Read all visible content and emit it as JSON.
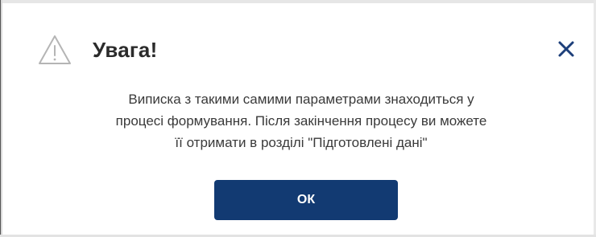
{
  "dialog": {
    "icon": "warning-triangle-icon",
    "title": "Увага!",
    "close_icon": "close-icon",
    "message_lines": [
      "Виписка з такими самими параметрами знаходиться у",
      "процесі формування. Після закінчення процесу ви можете",
      "її отримати в розділі \"Підготовлені дані\""
    ],
    "ok_label": "ОК"
  },
  "colors": {
    "accent": "#123a72",
    "close_icon": "#1d3f7a",
    "title": "#2b2b2b",
    "text": "#3a3a3a",
    "warning_icon": "#b5b5b5"
  }
}
